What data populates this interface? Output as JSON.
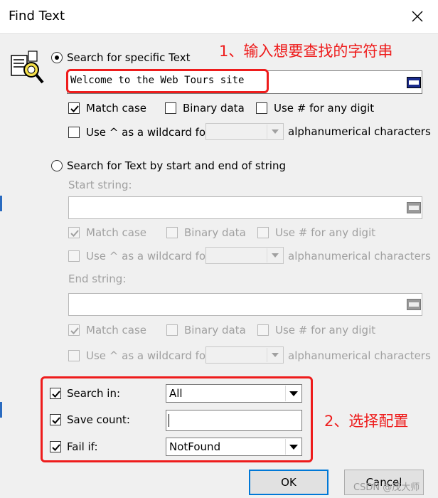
{
  "window": {
    "title": "Find Text"
  },
  "colors": {
    "annotation": "#ee1c1c",
    "accent": "#2a6bc0"
  },
  "icons": {
    "close": "close-icon",
    "find": "find-text-icon",
    "abc": "abc-picker-icon",
    "dropdown": "chevron-down-icon"
  },
  "specific": {
    "radio_label": "Search for specific Text",
    "text_value": "Welcome to the Web Tours site",
    "match_case": "Match case",
    "binary_data": "Binary data",
    "use_hash": "Use # for any digit",
    "use_caret": "Use ^ as a wildcard for",
    "wildcard_value": "",
    "alnum": "alphanumerical characters"
  },
  "by_start_end": {
    "radio_label": "Search for Text by start and end of string",
    "start_label": "Start string:",
    "start_value": "",
    "end_label": "End string:",
    "end_value": "",
    "match_case": "Match case",
    "binary_data": "Binary data",
    "use_hash": "Use # for any digit",
    "use_caret": "Use ^ as a wildcard for",
    "alnum": "alphanumerical characters"
  },
  "options": {
    "search_in_label": "Search in:",
    "search_in_value": "All",
    "save_count_label": "Save count:",
    "save_count_value": "",
    "fail_if_label": "Fail if:",
    "fail_if_value": "NotFound"
  },
  "annotations": {
    "note1": "1、输入想要查找的字符串",
    "note2": "2、选择配置"
  },
  "buttons": {
    "ok": "OK",
    "cancel": "Cancel"
  },
  "watermark": "CSDN @茂大师"
}
